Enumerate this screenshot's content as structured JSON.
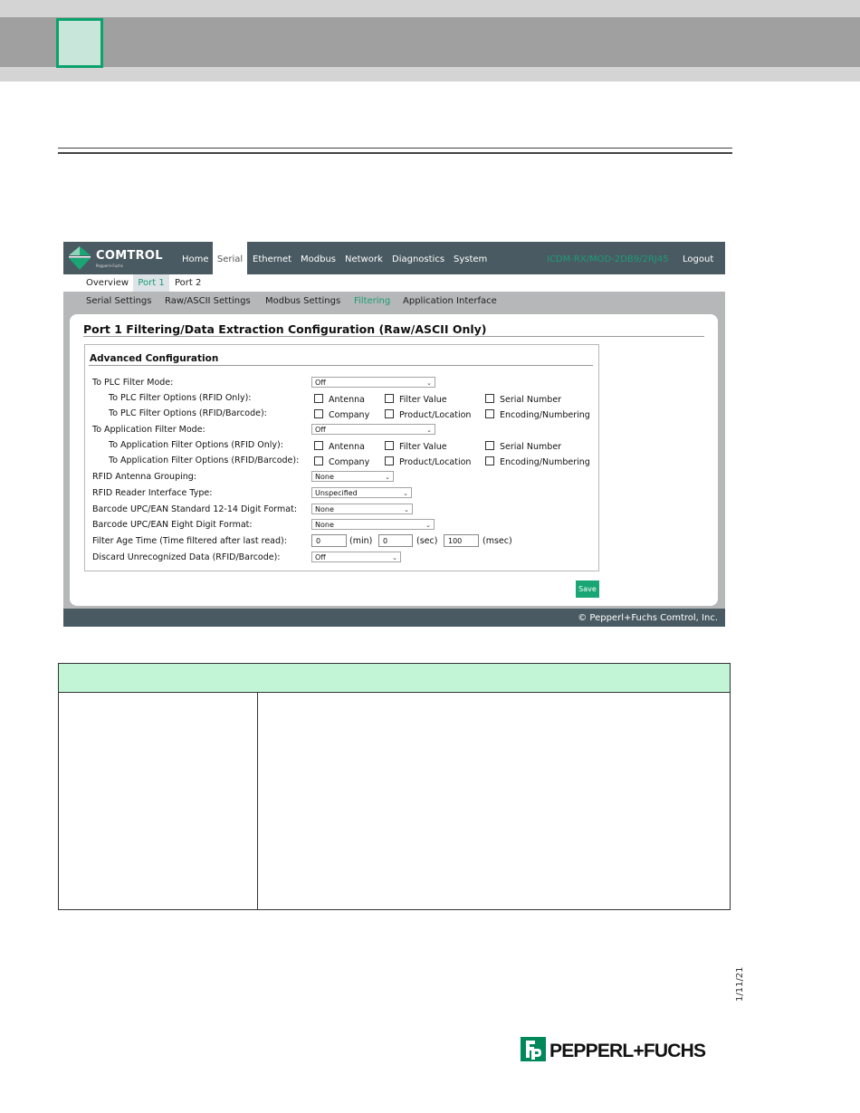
{
  "colors": {
    "accent": "#1aa674",
    "nav_bg": "#4a5a62",
    "table_header": "#c2f5d6",
    "section_square": "#0aa26d"
  },
  "nav": {
    "logo_text": "COMTROL",
    "logo_sub": "Pepperl+Fuchs",
    "items": [
      "Home",
      "Serial",
      "Ethernet",
      "Modbus",
      "Network",
      "Diagnostics",
      "System"
    ],
    "active": "Serial",
    "device_name": "ICDM-RX/MOD-2DB9/2RJ45",
    "logout": "Logout"
  },
  "subnav": {
    "items": [
      "Overview",
      "Port 1",
      "Port 2"
    ],
    "active": "Port 1"
  },
  "subnav2": {
    "items": [
      "Serial Settings",
      "Raw/ASCII Settings",
      "Modbus Settings",
      "Filtering",
      "Application Interface"
    ],
    "active": "Filtering"
  },
  "page_title": "Port 1 Filtering/Data Extraction Configuration (Raw/ASCII Only)",
  "section_title": "Advanced Configuration",
  "form": {
    "plc_filter_mode": {
      "label": "To PLC Filter Mode:",
      "value": "Off"
    },
    "plc_rfid_only": {
      "label": "To PLC Filter Options (RFID Only):",
      "options": [
        "Antenna",
        "Filter Value",
        "Serial Number"
      ]
    },
    "plc_rfid_barcode": {
      "label": "To PLC Filter Options (RFID/Barcode):",
      "options": [
        "Company",
        "Product/Location",
        "Encoding/Numbering"
      ]
    },
    "app_filter_mode": {
      "label": "To Application Filter Mode:",
      "value": "Off"
    },
    "app_rfid_only": {
      "label": "To Application Filter Options (RFID Only):",
      "options": [
        "Antenna",
        "Filter Value",
        "Serial Number"
      ]
    },
    "app_rfid_barcode": {
      "label": "To Application Filter Options (RFID/Barcode):",
      "options": [
        "Company",
        "Product/Location",
        "Encoding/Numbering"
      ]
    },
    "antenna_grouping": {
      "label": "RFID Antenna Grouping:",
      "value": "None"
    },
    "reader_type": {
      "label": "RFID Reader Interface Type:",
      "value": "Unspecified"
    },
    "upc_12_14": {
      "label": "Barcode UPC/EAN Standard 12-14 Digit Format:",
      "value": "None"
    },
    "upc_8": {
      "label": "Barcode UPC/EAN Eight Digit Format:",
      "value": "None"
    },
    "filter_age": {
      "label": "Filter Age Time (Time filtered after last read):",
      "min": "0",
      "sec": "0",
      "msec": "100",
      "min_unit": "(min)",
      "sec_unit": "(sec)",
      "msec_unit": "(msec)"
    },
    "discard": {
      "label": "Discard Unrecognized Data (RFID/Barcode):",
      "value": "Off"
    }
  },
  "save_label": "Save",
  "copyright": "© Pepperl+Fuchs Comtrol, Inc.",
  "date": "1/11/21",
  "brand": "PEPPERL+FUCHS"
}
